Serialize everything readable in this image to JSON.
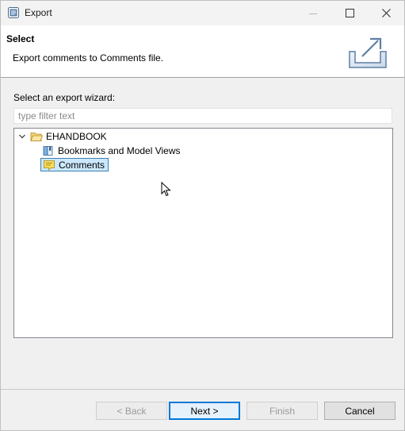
{
  "window": {
    "title": "Export",
    "icon": "eclipse-export-icon"
  },
  "banner": {
    "title": "Select",
    "description": "Export comments to Comments file.",
    "graphic": "export-wizard-icon"
  },
  "wizard": {
    "label": "Select an export wizard:",
    "filter_placeholder": "type filter text",
    "filter_value": ""
  },
  "tree": {
    "root": {
      "label": "EHANDBOOK",
      "expanded": true,
      "icon": "open-folder-icon"
    },
    "children": [
      {
        "label": "Bookmarks and Model Views",
        "icon": "bookmark-book-icon",
        "selected": false
      },
      {
        "label": "Comments",
        "icon": "comment-note-icon",
        "selected": true
      }
    ]
  },
  "buttons": {
    "back": {
      "label": "< Back",
      "enabled": false
    },
    "next": {
      "label": "Next >",
      "enabled": true,
      "default": true
    },
    "finish": {
      "label": "Finish",
      "enabled": false
    },
    "cancel": {
      "label": "Cancel",
      "enabled": true
    }
  },
  "colors": {
    "selection_bg": "#cce8ff",
    "selection_border": "#3c7fb1",
    "accent": "#0078d7"
  }
}
